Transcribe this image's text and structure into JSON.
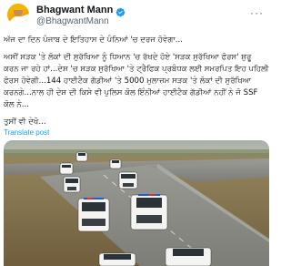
{
  "author": {
    "display_name": "Bhagwant Mann",
    "handle": "@BhagwantMann",
    "verified": true
  },
  "tweet": {
    "text_lines": [
      "ਅੱਜ ਦਾ ਦਿਨ ਪੰਜਾਬ ਦੇ ਇਤਿਹਾਸ ਦੇ ਪੰਨਿਆਂ 'ਚ ਦਰਜ ਹੋਵੇਗਾ...",
      "",
      "ਅਸੀਂ ਸੜਕ 'ਤੇ ਲੋਕਾਂ ਦੀ ਸੁਰੱਖਿਆ ਨੂੰ ਧਿਆਨ 'ਚ ਰੱਖਦੇ ਹੋਏ 'ਸੜਕ ਸੁਰੱਖਿਆ ਫੋਰਸ' ਸ਼ੁਰੂ",
      "ਕਰਨ ਜਾ ਰਹੇ ਹਾਂ...ਦੇਸ਼ 'ਚ ਸੜਕ ਸੁਰੱਖਿਆ 'ਤੇ ਟ੍ਰੈਫਿਕ ਪ੍ਰਬੰਧਕ ਲਈ ਸਮਰਪਿਤ ਇਹ ਪਹਿਲੀ",
      "ਫੋਰਸ ਹੋਵੇਗੀ...144 ਹਾਈਟੈਕ ਗੱਡੀਆਂ 'ਤੇ 5000 ਮੁਲਾਜ਼ਮ ਸੜਕ 'ਤੇ ਲੋਕਾਂ ਦੀ ਸੁਰੱਖਿਆ",
      "ਕਰਨਗੇ...ਨਾਲ ਹੀ ਦੇਸ਼ ਦੀ ਕਿਸੇ ਵੀ ਪੁਲਿਸ ਕੋਲ ਇੰਨੀਆਂ ਹਾਈਟੈਕ ਗੱਡੀਆਂ ਨਹੀਂ ਨੇ ਜੋ SSF",
      "ਕੋਲ ਨੇ...",
      "",
      "ਤੁਸੀਂ ਵੀ ਦੇਖੋ..."
    ],
    "translate_label": "Translate post"
  },
  "media": {
    "description_icon": "video-thumbnail",
    "vehicle_color": "#f4f4f2"
  }
}
